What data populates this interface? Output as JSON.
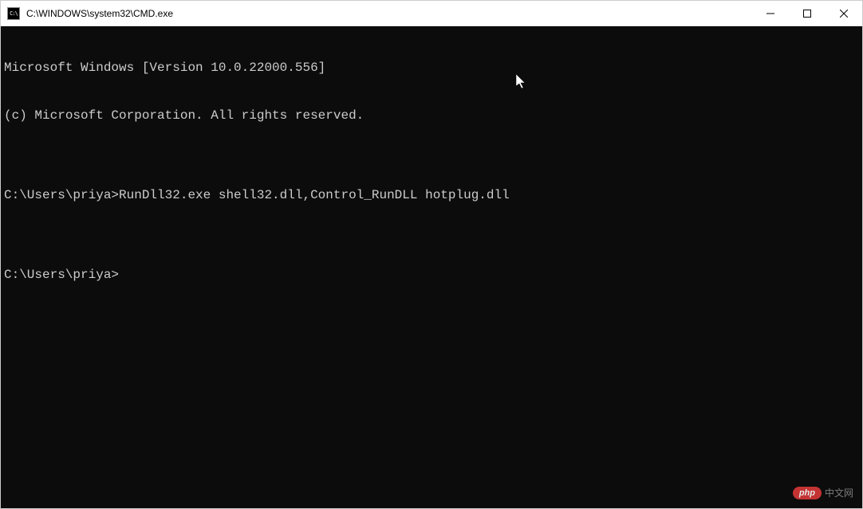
{
  "titlebar": {
    "icon_label": "CMD",
    "title": "C:\\WINDOWS\\system32\\CMD.exe"
  },
  "terminal": {
    "lines": [
      "Microsoft Windows [Version 10.0.22000.556]",
      "(c) Microsoft Corporation. All rights reserved.",
      "",
      "C:\\Users\\priya>RunDll32.exe shell32.dll,Control_RunDLL hotplug.dll",
      "",
      "C:\\Users\\priya>"
    ]
  },
  "watermark": {
    "badge": "php",
    "text": "中文网"
  }
}
